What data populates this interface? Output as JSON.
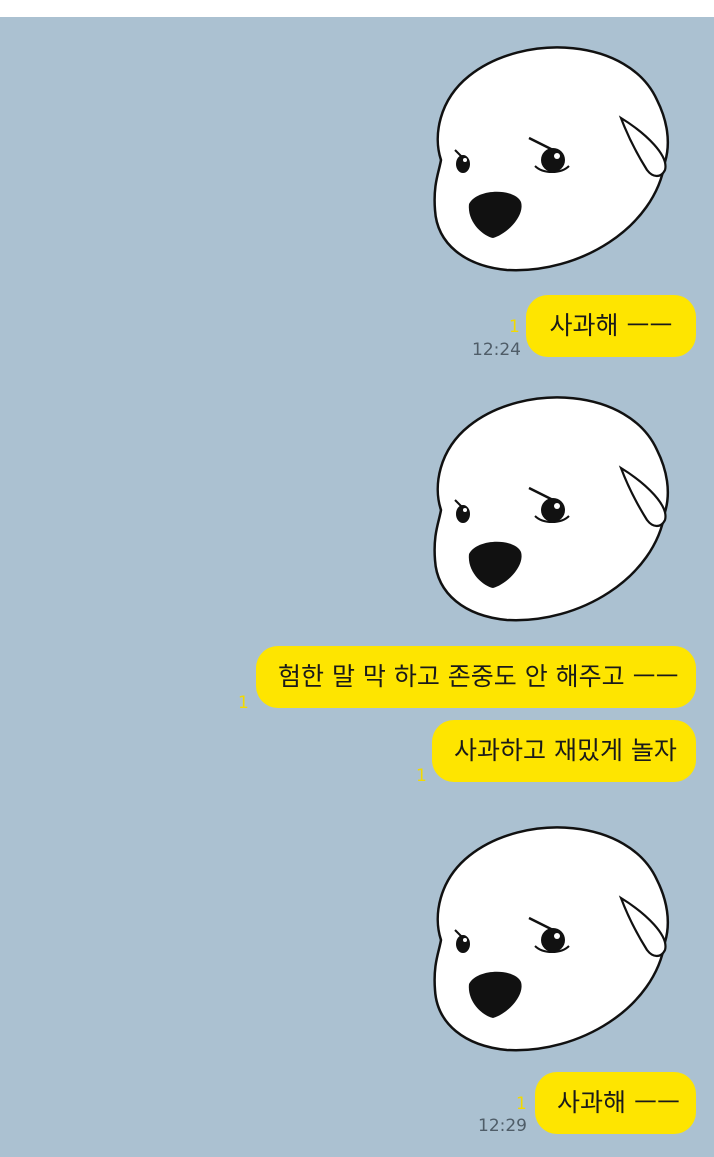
{
  "chat": {
    "stickers": [
      {
        "name": "angry-puppy-sticker"
      },
      {
        "name": "angry-puppy-sticker"
      },
      {
        "name": "angry-puppy-sticker"
      }
    ],
    "messages": [
      {
        "text": "사과해 ㅡㅡ",
        "unread": "1",
        "time": "12:24"
      },
      {
        "text": "험한 말 막 하고 존중도 안 해주고 ㅡㅡ",
        "unread": "1",
        "time": ""
      },
      {
        "text": "사과하고 재밌게 놀자",
        "unread": "1",
        "time": ""
      },
      {
        "text": "사과해 ㅡㅡ",
        "unread": "1",
        "time": "12:29"
      }
    ]
  },
  "colors": {
    "background": "#abc1d1",
    "bubble": "#fee500",
    "unread": "#f2d900",
    "time": "#4f5d68"
  }
}
